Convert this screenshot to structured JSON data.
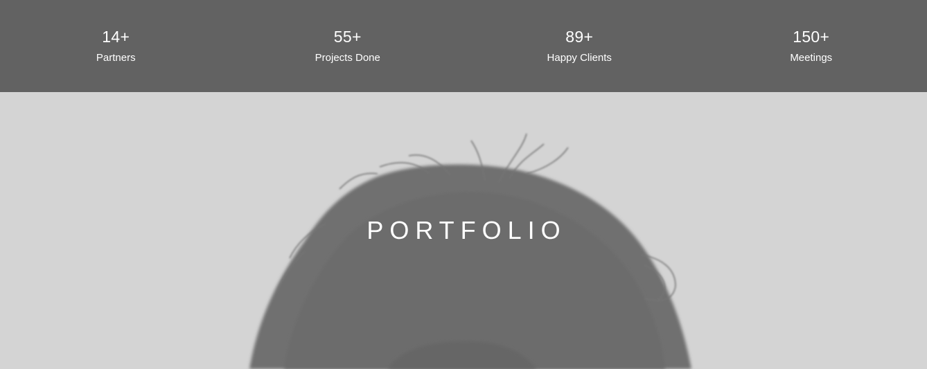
{
  "stats": {
    "items": [
      {
        "number": "14+",
        "label": "Partners"
      },
      {
        "number": "55+",
        "label": "Projects Done"
      },
      {
        "number": "89+",
        "label": "Happy Clients"
      },
      {
        "number": "150+",
        "label": "Meetings"
      }
    ]
  },
  "hero": {
    "title": "PORTFOLIO"
  },
  "colors": {
    "stats_background": "#626262",
    "hero_background": "#d4d4d4",
    "text": "#ffffff"
  }
}
